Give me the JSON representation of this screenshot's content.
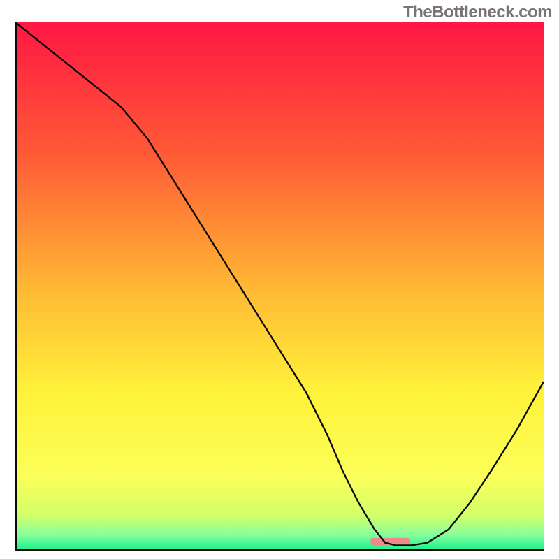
{
  "watermark": "TheBottleneck.com",
  "chart_data": {
    "type": "line",
    "title": "",
    "xlabel": "",
    "ylabel": "",
    "xlim": [
      0,
      100
    ],
    "ylim": [
      0,
      100
    ],
    "x": [
      0,
      5,
      10,
      15,
      20,
      25,
      30,
      35,
      40,
      45,
      50,
      55,
      59,
      62,
      65,
      68,
      70,
      72,
      75,
      78,
      82,
      86,
      90,
      95,
      100
    ],
    "values": [
      100,
      96,
      92,
      88,
      84,
      78,
      70,
      62,
      54,
      46,
      38,
      30,
      22,
      15,
      9,
      4,
      1.5,
      1,
      1,
      1.5,
      4,
      9,
      15,
      23,
      32
    ],
    "marker": {
      "x": 71,
      "y": 1.7,
      "w": 7.5,
      "h": 1.4,
      "color": "#f08a8a"
    },
    "gradient_stops": [
      {
        "offset": 0.0,
        "color": "#ff1744"
      },
      {
        "offset": 0.25,
        "color": "#ff5a36"
      },
      {
        "offset": 0.5,
        "color": "#ffb734"
      },
      {
        "offset": 0.7,
        "color": "#fff23a"
      },
      {
        "offset": 0.86,
        "color": "#fbff59"
      },
      {
        "offset": 0.935,
        "color": "#d0ff6a"
      },
      {
        "offset": 0.97,
        "color": "#87ff9d"
      },
      {
        "offset": 1.0,
        "color": "#14f28c"
      }
    ],
    "axis_color": "#0a0a0a",
    "line_color": "#0a0a0a"
  }
}
